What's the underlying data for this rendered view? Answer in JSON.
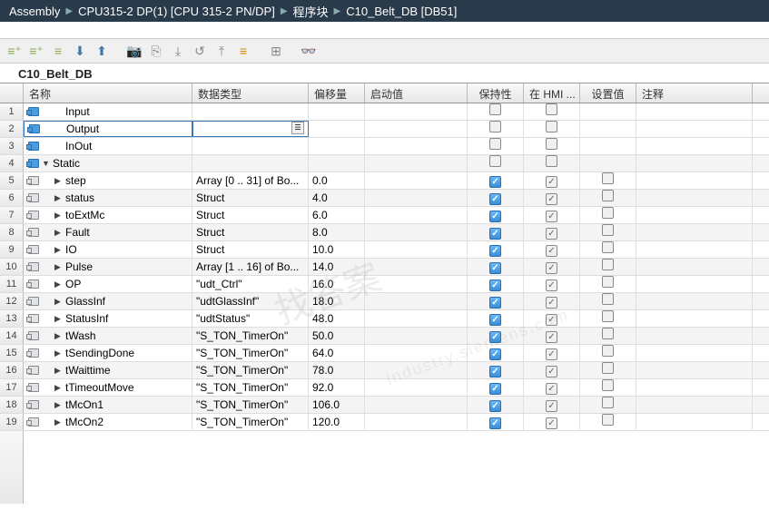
{
  "breadcrumb": [
    "Assembly",
    "CPU315-2 DP(1) [CPU 315-2 PN/DP]",
    "程序块",
    "C10_Belt_DB [DB51]"
  ],
  "tab_title": "C10_Belt_DB",
  "columns": {
    "name": "名称",
    "type": "数据类型",
    "offset": "偏移量",
    "start": "启动值",
    "retain": "保持性",
    "hmi": "在 HMI ...",
    "setval": "设置值",
    "comment": "注释"
  },
  "rows": [
    {
      "n": 1,
      "icon": "db",
      "expand": "",
      "name": "Input",
      "type": "",
      "off": "",
      "ret": "g",
      "hmi": "g",
      "set": "",
      "indent": 1,
      "sel": false
    },
    {
      "n": 2,
      "icon": "db",
      "expand": "",
      "name": "Output",
      "type": "",
      "off": "",
      "ret": "g",
      "hmi": "g",
      "set": "",
      "indent": 1,
      "sel": true,
      "dd": true
    },
    {
      "n": 3,
      "icon": "db",
      "expand": "",
      "name": "InOut",
      "type": "",
      "off": "",
      "ret": "g",
      "hmi": "g",
      "set": "",
      "indent": 1,
      "sel": false
    },
    {
      "n": 4,
      "icon": "db",
      "expand": "down",
      "name": "Static",
      "type": "",
      "off": "",
      "ret": "g",
      "hmi": "g",
      "set": "",
      "indent": 0,
      "sel": false
    },
    {
      "n": 5,
      "icon": "struct",
      "expand": "right",
      "name": "step",
      "type": "Array [0 .. 31] of Bo...",
      "off": "0.0",
      "ret": "b",
      "hmi": "gc",
      "set": "g",
      "indent": 1,
      "sel": false
    },
    {
      "n": 6,
      "icon": "struct",
      "expand": "right",
      "name": "status",
      "type": "Struct",
      "off": "4.0",
      "ret": "b",
      "hmi": "gc",
      "set": "g",
      "indent": 1,
      "sel": false
    },
    {
      "n": 7,
      "icon": "struct",
      "expand": "right",
      "name": "toExtMc",
      "type": "Struct",
      "off": "6.0",
      "ret": "b",
      "hmi": "gc",
      "set": "g",
      "indent": 1,
      "sel": false
    },
    {
      "n": 8,
      "icon": "struct",
      "expand": "right",
      "name": "Fault",
      "type": "Struct",
      "off": "8.0",
      "ret": "b",
      "hmi": "gc",
      "set": "g",
      "indent": 1,
      "sel": false
    },
    {
      "n": 9,
      "icon": "struct",
      "expand": "right",
      "name": "IO",
      "type": "Struct",
      "off": "10.0",
      "ret": "b",
      "hmi": "gc",
      "set": "g",
      "indent": 1,
      "sel": false
    },
    {
      "n": 10,
      "icon": "struct",
      "expand": "right",
      "name": "Pulse",
      "type": "Array [1 .. 16] of Bo...",
      "off": "14.0",
      "ret": "b",
      "hmi": "gc",
      "set": "g",
      "indent": 1,
      "sel": false
    },
    {
      "n": 11,
      "icon": "struct",
      "expand": "right",
      "name": "OP",
      "type": "\"udt_Ctrl\"",
      "off": "16.0",
      "ret": "b",
      "hmi": "gc",
      "set": "g",
      "indent": 1,
      "sel": false
    },
    {
      "n": 12,
      "icon": "struct",
      "expand": "right",
      "name": "GlassInf",
      "type": "\"udtGlassInf\"",
      "off": "18.0",
      "ret": "b",
      "hmi": "gc",
      "set": "g",
      "indent": 1,
      "sel": false
    },
    {
      "n": 13,
      "icon": "struct",
      "expand": "right",
      "name": "StatusInf",
      "type": "\"udtStatus\"",
      "off": "48.0",
      "ret": "b",
      "hmi": "gc",
      "set": "g",
      "indent": 1,
      "sel": false
    },
    {
      "n": 14,
      "icon": "struct",
      "expand": "right",
      "name": "tWash",
      "type": "\"S_TON_TimerOn\"",
      "off": "50.0",
      "ret": "b",
      "hmi": "gc",
      "set": "g",
      "indent": 1,
      "sel": false
    },
    {
      "n": 15,
      "icon": "struct",
      "expand": "right",
      "name": "tSendingDone",
      "type": "\"S_TON_TimerOn\"",
      "off": "64.0",
      "ret": "b",
      "hmi": "gc",
      "set": "g",
      "indent": 1,
      "sel": false
    },
    {
      "n": 16,
      "icon": "struct",
      "expand": "right",
      "name": "tWaittime",
      "type": "\"S_TON_TimerOn\"",
      "off": "78.0",
      "ret": "b",
      "hmi": "gc",
      "set": "g",
      "indent": 1,
      "sel": false
    },
    {
      "n": 17,
      "icon": "struct",
      "expand": "right",
      "name": "tTimeoutMove",
      "type": "\"S_TON_TimerOn\"",
      "off": "92.0",
      "ret": "b",
      "hmi": "gc",
      "set": "g",
      "indent": 1,
      "sel": false
    },
    {
      "n": 18,
      "icon": "struct",
      "expand": "right",
      "name": "tMcOn1",
      "type": "\"S_TON_TimerOn\"",
      "off": "106.0",
      "ret": "b",
      "hmi": "gc",
      "set": "g",
      "indent": 1,
      "sel": false
    },
    {
      "n": 19,
      "icon": "struct",
      "expand": "right",
      "name": "tMcOn2",
      "type": "\"S_TON_TimerOn\"",
      "off": "120.0",
      "ret": "b",
      "hmi": "gc",
      "set": "g",
      "indent": 1,
      "sel": false
    }
  ],
  "toolbar_icons": [
    "insert-row",
    "insert-row-after",
    "add-row",
    "import",
    "export",
    "snapshot",
    "copy-snapshot",
    "load-start",
    "reset",
    "init-start",
    "structure",
    "expand",
    "monitor"
  ],
  "watermark": "找答案",
  "watermark2": "industry.siemens.com"
}
